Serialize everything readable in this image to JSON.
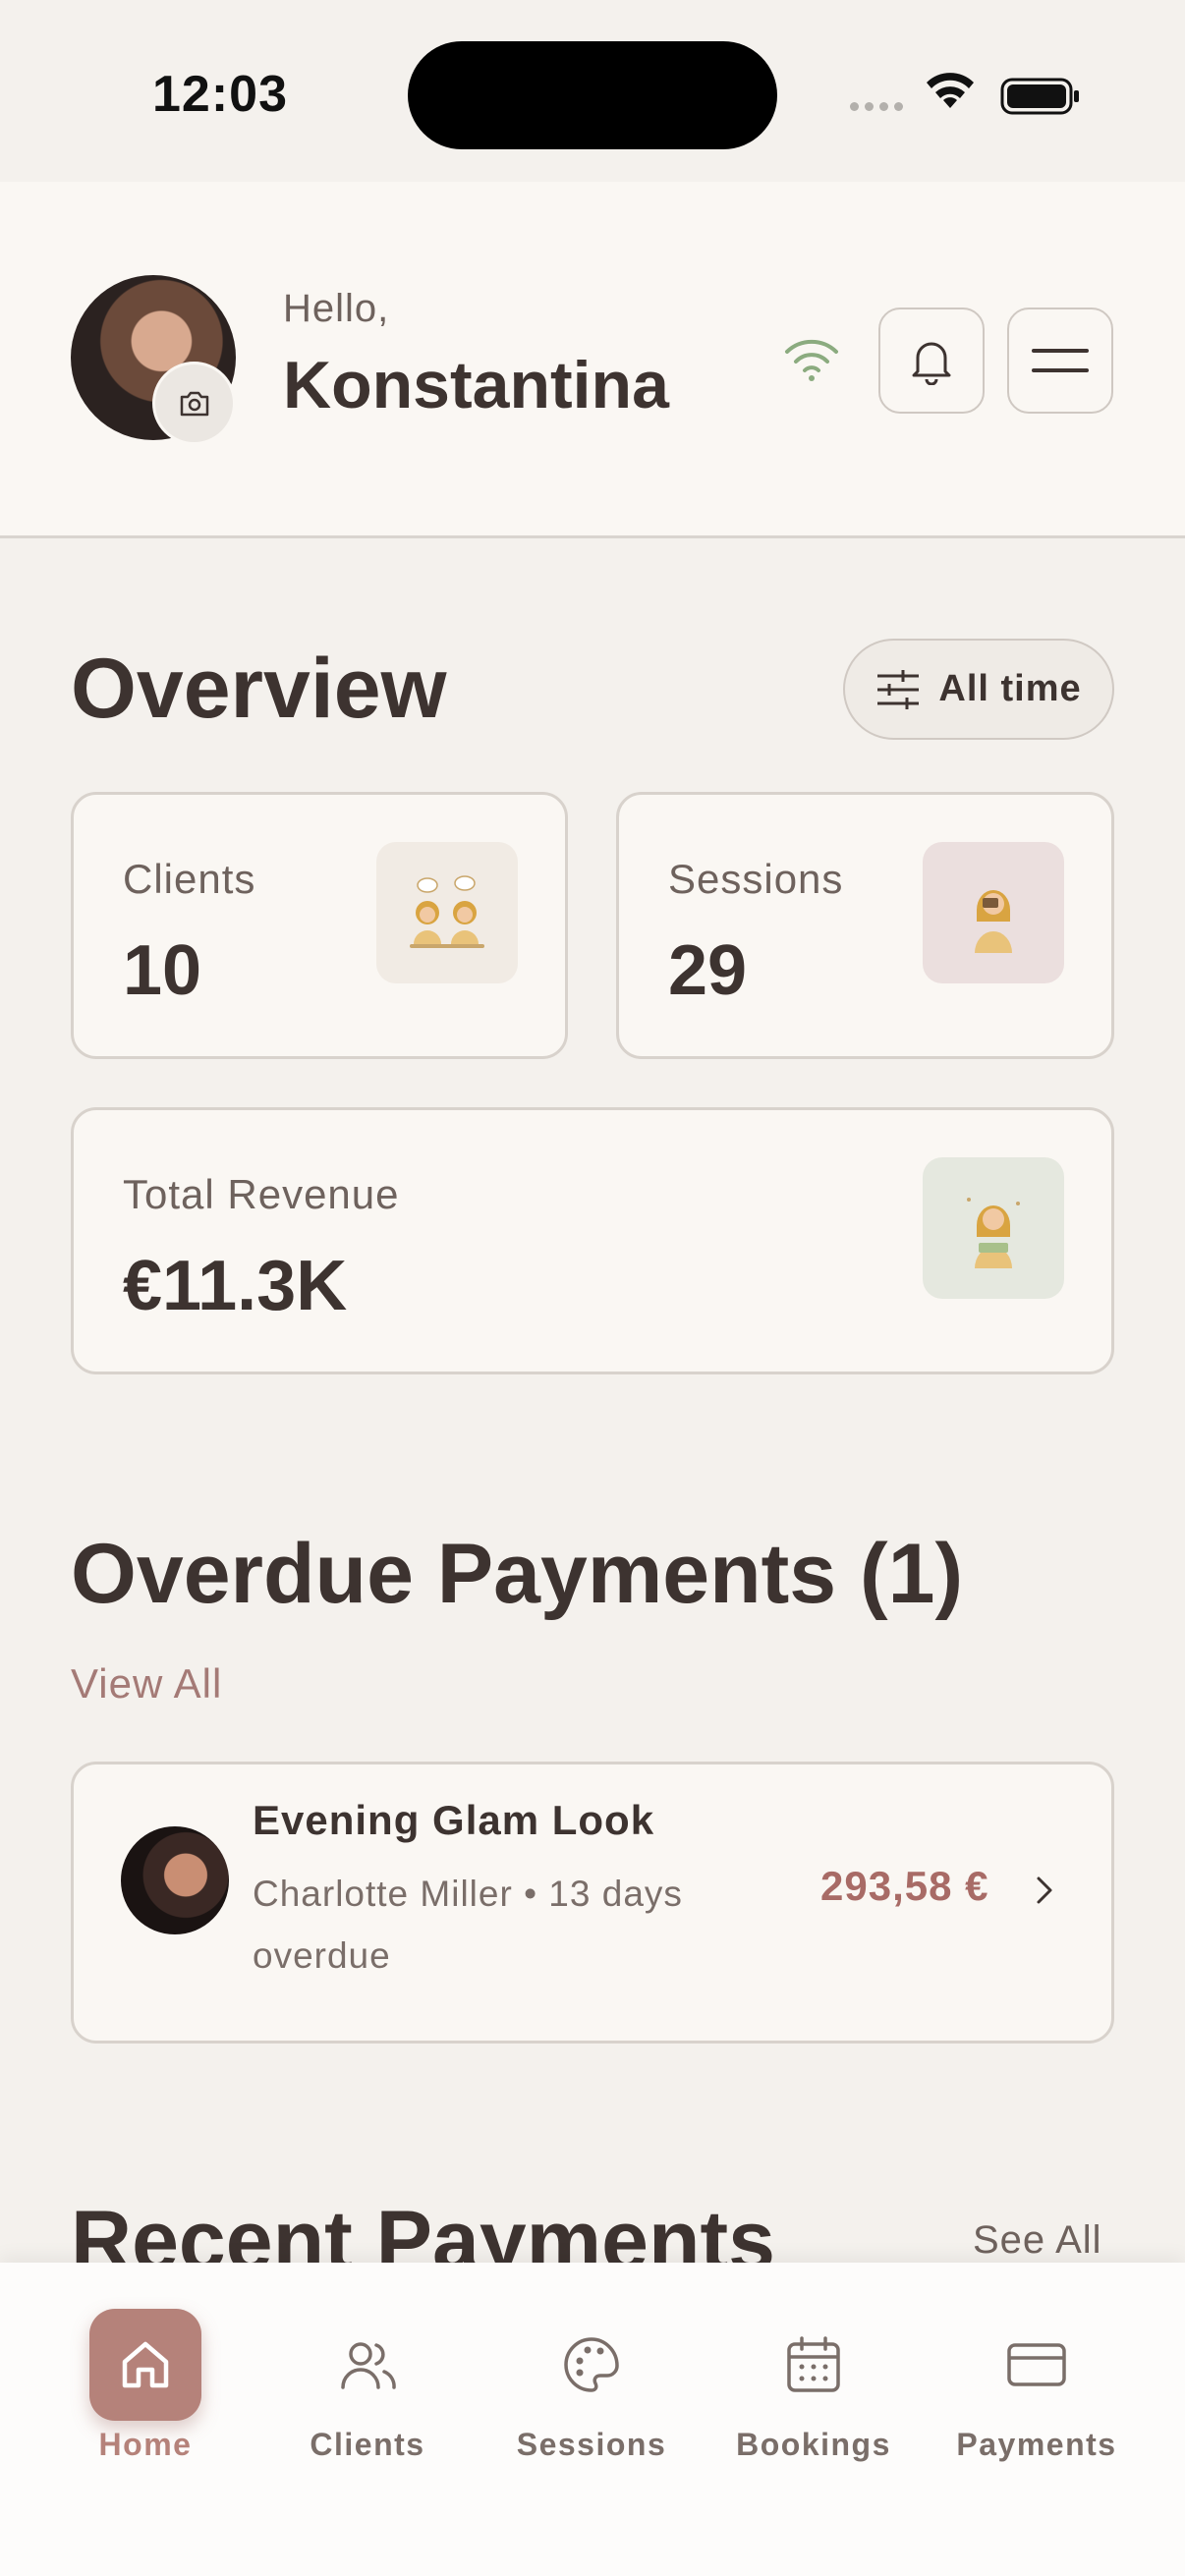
{
  "status_bar": {
    "time": "12:03"
  },
  "header": {
    "greeting": "Hello,",
    "user_name": "Konstantina"
  },
  "overview": {
    "title": "Overview",
    "filter_label": "All time",
    "stats": {
      "clients": {
        "label": "Clients",
        "value": "10"
      },
      "sessions": {
        "label": "Sessions",
        "value": "29"
      },
      "revenue": {
        "label": "Total Revenue",
        "value": "€11.3K"
      }
    }
  },
  "overdue": {
    "title": "Overdue Payments (1)",
    "view_all": "View All",
    "items": [
      {
        "title": "Evening Glam Look",
        "subtitle": "Charlotte Miller • 13 days overdue",
        "amount": "293,58 €"
      }
    ]
  },
  "recent": {
    "title": "Recent Payments",
    "see_all": "See All"
  },
  "tabbar": {
    "tabs": [
      {
        "label": "Home",
        "icon": "home-icon",
        "active": true
      },
      {
        "label": "Clients",
        "icon": "users-icon",
        "active": false
      },
      {
        "label": "Sessions",
        "icon": "palette-icon",
        "active": false
      },
      {
        "label": "Bookings",
        "icon": "calendar-icon",
        "active": false
      },
      {
        "label": "Payments",
        "icon": "credit-card-icon",
        "active": false
      }
    ]
  },
  "colors": {
    "accent": "#b5827a",
    "background": "#f4f1ed",
    "card": "#faf7f3",
    "overdue_amount": "#a86b66",
    "connection": "#8bab7f"
  }
}
